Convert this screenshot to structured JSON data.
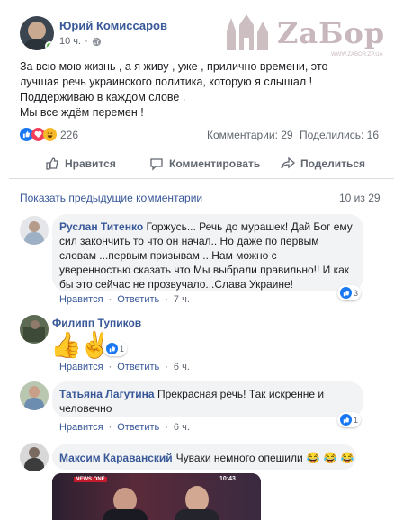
{
  "post": {
    "author": "Юрий Комиссаров",
    "time": "10 ч.",
    "text_lines": [
      "За всю мою жизнь , а я живу , уже , прилично времени, это",
      "лучшая речь украинского политика, которую я слышал !",
      "Поддерживаю в каждом слове .",
      "Мы все ждём перемен !"
    ],
    "reactions_count": "226",
    "comments_count": "Комментарии: 29",
    "shares_count": "Поделились: 16"
  },
  "watermark": {
    "brand": "ZaБор",
    "url": "WWW.ZABOR.ZP.UA"
  },
  "actions": {
    "like": "Нравится",
    "comment": "Комментировать",
    "share": "Поделиться"
  },
  "comments_header": {
    "show_previous": "Показать предыдущие комментарии",
    "counter": "10 из 29"
  },
  "comments": [
    {
      "author": "Руслан Титенко",
      "text_lines": [
        "Горжусь... Речь до мурашек! Дай Бог ему",
        "сил закончить то что он начал.. Но даже по первым",
        "словам ...первым призывам ...Нам можно с",
        "уверенностью сказать что Мы выбрали правильно!! И как",
        "бы это сейчас не прозвучало...Слава Украине!"
      ],
      "like": "Нравится",
      "reply": "Ответить",
      "time": "7 ч.",
      "reactions": "3"
    },
    {
      "author": "Филипп Тупиков",
      "emojis": [
        "👍",
        "✌"
      ],
      "like": "Нравится",
      "reply": "Ответить",
      "time": "6 ч.",
      "reactions": "1"
    },
    {
      "author": "Татьяна Лагутина",
      "text_lines": [
        "Прекрасная речь! Так искренне и",
        "человечно"
      ],
      "like": "Нравится",
      "reply": "Ответить",
      "time": "6 ч.",
      "reactions": "1"
    },
    {
      "author": "Максим Караванский",
      "text": "Чуваки немного опешили",
      "emojis": [
        "😂",
        "😂",
        "😂"
      ],
      "video_channel": "NEWS ONE",
      "video_time": "10:43"
    }
  ]
}
